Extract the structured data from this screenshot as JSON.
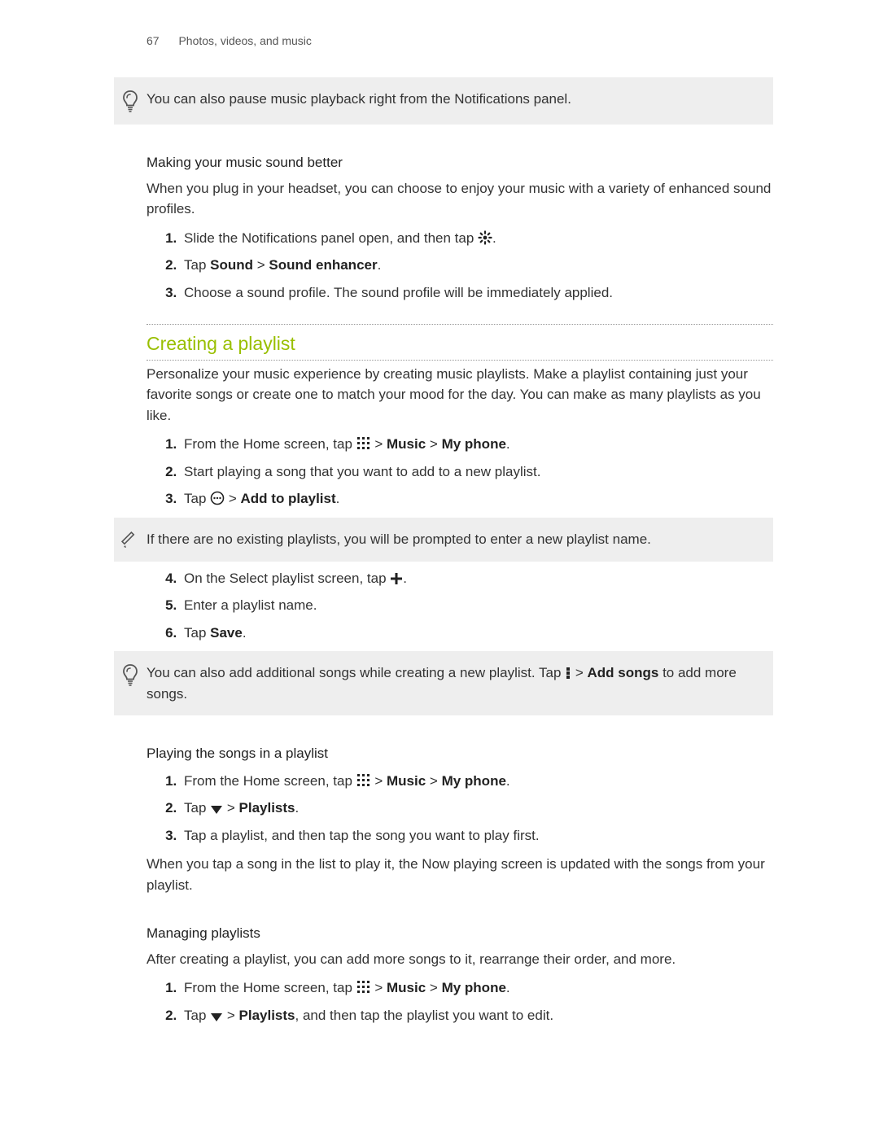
{
  "header": {
    "page_number": "67",
    "breadcrumb": "Photos, videos, and music"
  },
  "tip1": {
    "text": "You can also pause music playback right from the Notifications panel."
  },
  "sec_sound": {
    "heading": "Making your music sound better",
    "intro": "When you plug in your headset, you can choose to enjoy your music with a variety of enhanced sound profiles.",
    "step1_pre": "Slide the Notifications panel open, and then tap ",
    "step1_post": ".",
    "step2_pre": "Tap ",
    "step2_b1": "Sound",
    "step2_mid": " > ",
    "step2_b2": "Sound enhancer",
    "step2_post": ".",
    "step3": "Choose a sound profile. The sound profile will be immediately applied."
  },
  "sec_playlist": {
    "title": "Creating a playlist",
    "intro": "Personalize your music experience by creating music playlists. Make a playlist containing just your favorite songs or create one to match your mood for the day. You can make as many playlists as you like.",
    "s1_pre": "From the Home screen, tap ",
    "s1_mid1": " > ",
    "s1_b1": "Music",
    "s1_mid2": " > ",
    "s1_b2": "My phone",
    "s1_post": ".",
    "s2": "Start playing a song that you want to add to a new playlist.",
    "s3_pre": "Tap ",
    "s3_mid": " > ",
    "s3_b": "Add to playlist",
    "s3_post": "."
  },
  "note_playlist": {
    "text": "If there are no existing playlists, you will be prompted to enter a new playlist name."
  },
  "sec_playlist2": {
    "s4_pre": "On the Select playlist screen, tap ",
    "s4_post": ".",
    "s5": "Enter a playlist name.",
    "s6_pre": "Tap ",
    "s6_b": "Save",
    "s6_post": "."
  },
  "tip2": {
    "pre": "You can also add additional songs while creating a new playlist. Tap ",
    "mid": " > ",
    "b": "Add songs",
    "post": " to add more songs."
  },
  "sec_play": {
    "heading": "Playing the songs in a playlist",
    "s1_pre": "From the Home screen, tap ",
    "s1_mid1": "  > ",
    "s1_b1": "Music",
    "s1_mid2": " > ",
    "s1_b2": "My phone",
    "s1_post": ".",
    "s2_pre": "Tap ",
    "s2_mid": " > ",
    "s2_b": "Playlists",
    "s2_post": ".",
    "s3": "Tap a playlist, and then tap the song you want to play first.",
    "outro": "When you tap a song in the list to play it, the Now playing screen is updated with the songs from your playlist."
  },
  "sec_manage": {
    "heading": "Managing playlists",
    "intro": "After creating a playlist, you can add more songs to it, rearrange their order, and more.",
    "s1_pre": "From the Home screen, tap ",
    "s1_mid1": "  > ",
    "s1_b1": "Music",
    "s1_mid2": " > ",
    "s1_b2": "My phone",
    "s1_post": ".",
    "s2_pre": "Tap ",
    "s2_mid": " > ",
    "s2_b": "Playlists",
    "s2_post": ", and then tap the playlist you want to edit."
  }
}
